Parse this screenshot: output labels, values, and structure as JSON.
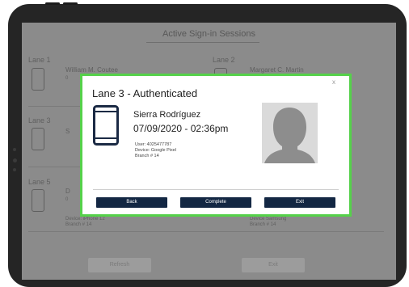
{
  "background": {
    "title": "Active Sign-in Sessions",
    "lanes": [
      {
        "label": "Lane 1",
        "name": "William M. Coutee",
        "partial_line": "0"
      },
      {
        "label": "Lane 2",
        "name": "Margaret C. Martin"
      },
      {
        "label": "Lane 3",
        "name_partial": "S"
      },
      {
        "label": "Lane 5",
        "name_partial": "D",
        "sub_partial": "0",
        "device": "Device: iPhone 12",
        "branch": "Branch # 14"
      },
      {
        "device": "Device Samsung",
        "branch": "Branch # 14"
      }
    ],
    "refresh_label": "Refresh",
    "exit_label": "Exit"
  },
  "modal": {
    "close_label": "x",
    "title": "Lane 3 - Authenticated",
    "name": "Sierra Rodríguez",
    "datetime": "07/09/2020 - 02:36pm",
    "user_line": "User: 4025477787",
    "device_line": "Device: Google Pixel",
    "branch_line": "Branch # 14",
    "buttons": {
      "back": "Back",
      "complete": "Complete",
      "exit": "Exit"
    }
  },
  "colors": {
    "modal_border": "#55d14a",
    "button_bg": "#132743",
    "tablet": "#252525"
  },
  "icons": {
    "device": "phone-icon",
    "avatar": "person-silhouette"
  }
}
